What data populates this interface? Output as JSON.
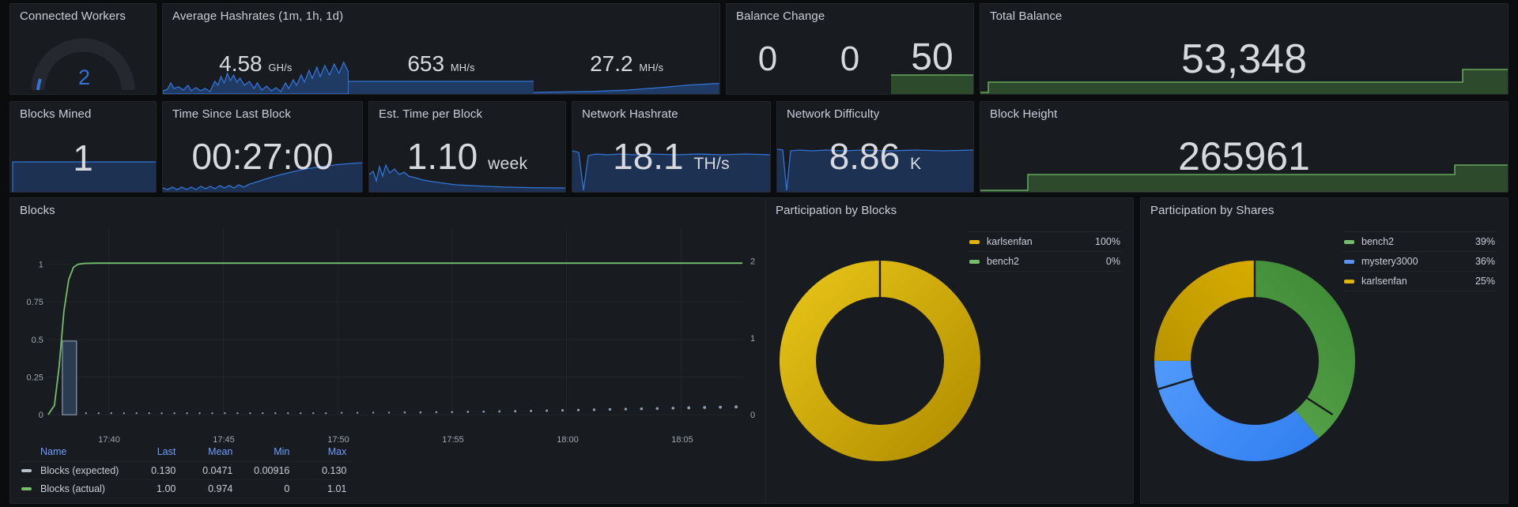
{
  "colors": {
    "panel_bg": "#181b1f",
    "page_bg": "#0b0c0e",
    "text": "#d8d9de",
    "title": "#ccccdc",
    "blue": "#3274d9",
    "light_blue": "#5794f2",
    "green": "#73bf69",
    "yellow": "#e0b400",
    "axis": "#9fa7b3"
  },
  "panels": {
    "connected_workers": {
      "title": "Connected Workers",
      "value": "2"
    },
    "average_hashrates": {
      "title": "Average Hashrates (1m, 1h, 1d)",
      "stats": [
        {
          "value": "4.58",
          "unit": "GH/s"
        },
        {
          "value": "653",
          "unit": "MH/s"
        },
        {
          "value": "27.2",
          "unit": "MH/s"
        }
      ]
    },
    "balance_change": {
      "title": "Balance Change",
      "stats": [
        {
          "value": "0",
          "unit": ""
        },
        {
          "value": "0",
          "unit": ""
        },
        {
          "value": "50",
          "unit": ""
        }
      ]
    },
    "total_balance": {
      "title": "Total Balance",
      "value": "53,348"
    },
    "blocks_mined": {
      "title": "Blocks Mined",
      "value": "1"
    },
    "time_since_last_block": {
      "title": "Time Since Last Block",
      "value": "00:27:00"
    },
    "est_time_per_block": {
      "title": "Est. Time per Block",
      "value": "1.10",
      "unit": "week"
    },
    "network_hashrate": {
      "title": "Network Hashrate",
      "value": "18.1",
      "unit": "TH/s"
    },
    "network_difficulty": {
      "title": "Network Difficulty",
      "value": "8.86",
      "unit": "K"
    },
    "block_height": {
      "title": "Block Height",
      "value": "265961"
    },
    "blocks": {
      "title": "Blocks"
    },
    "participation_by_blocks": {
      "title": "Participation by Blocks"
    },
    "participation_by_shares": {
      "title": "Participation by Shares"
    }
  },
  "chart_data": [
    {
      "id": "blocks",
      "type": "line",
      "title": "Blocks",
      "xlabel": "",
      "ylabel": "",
      "x_ticks": [
        "17:40",
        "17:45",
        "17:50",
        "17:55",
        "18:00",
        "18:05"
      ],
      "y_left_ticks": [
        "0",
        "0.25",
        "0.5",
        "0.75",
        "1"
      ],
      "y_right_ticks": [
        "0",
        "1",
        "2"
      ],
      "ylim_left": [
        0,
        1.1
      ],
      "ylim_right": [
        0,
        2.2
      ],
      "grid": true,
      "legend_position": "bottom-table",
      "legend_columns": [
        "Name",
        "Last",
        "Mean",
        "Min",
        "Max"
      ],
      "series": [
        {
          "name": "Blocks (expected)",
          "color": "#b8bfc9",
          "style": "dotted-bar",
          "last": "0.130",
          "mean": "0.0471",
          "min": "0.00916",
          "max": "0.130"
        },
        {
          "name": "Blocks (actual)",
          "color": "#73bf69",
          "style": "line",
          "last": "1.00",
          "mean": "0.974",
          "min": "0",
          "max": "1.01"
        }
      ]
    },
    {
      "id": "participation_by_blocks",
      "type": "pie",
      "title": "Participation by Blocks",
      "legend_position": "right",
      "labels": [
        "karlsenfan",
        "bench2"
      ],
      "values": [
        100,
        0
      ],
      "value_labels": [
        "100%",
        "0%"
      ],
      "colors": [
        "#e0b400",
        "#73bf69"
      ]
    },
    {
      "id": "participation_by_shares",
      "type": "pie",
      "title": "Participation by Shares",
      "legend_position": "right",
      "labels": [
        "bench2",
        "mystery3000",
        "karlsenfan"
      ],
      "values": [
        39,
        36,
        25
      ],
      "value_labels": [
        "39%",
        "36%",
        "25%"
      ],
      "colors": [
        "#56a64b",
        "#3e8ef7",
        "#d2a200"
      ]
    }
  ]
}
